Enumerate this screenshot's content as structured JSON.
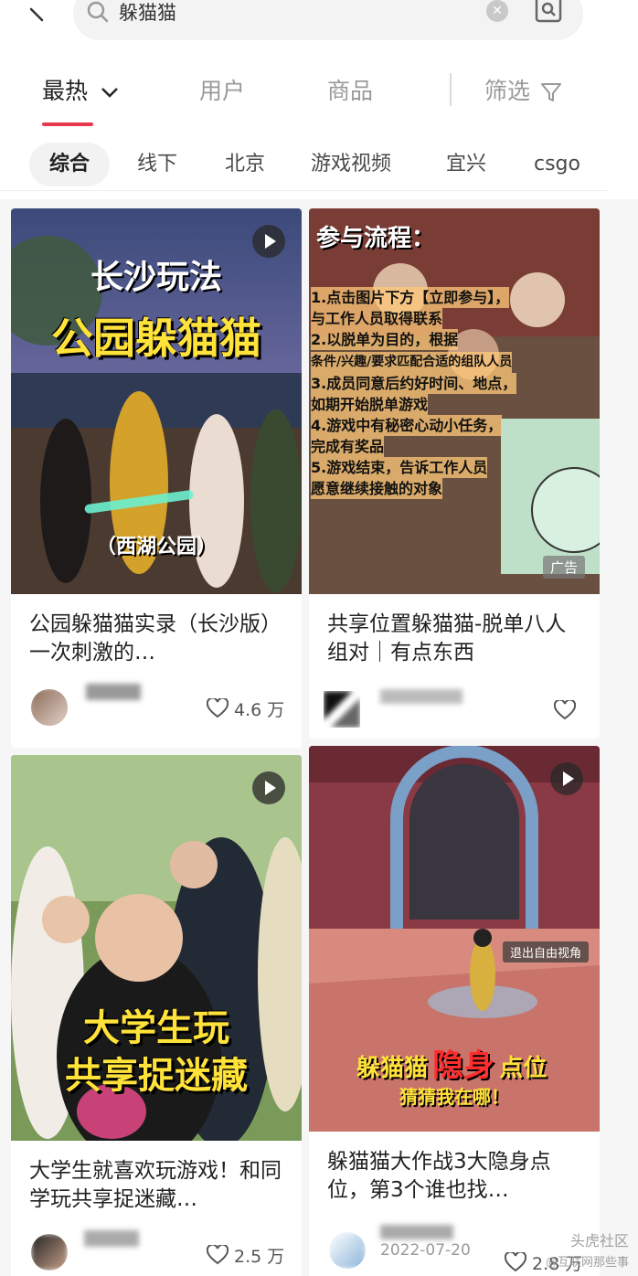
{
  "search": {
    "query": "躲猫猫"
  },
  "tabs": [
    {
      "label": "最热"
    },
    {
      "label": "用户"
    },
    {
      "label": "商品"
    },
    {
      "label": "筛选"
    }
  ],
  "chips": [
    "综合",
    "线下",
    "北京",
    "游戏视频",
    "宜兴",
    "csgo"
  ],
  "cards": [
    {
      "thumb_lines": [
        "长沙玩法",
        "公园躲猫猫",
        "（西湖公园）"
      ],
      "title": "公园躲猫猫实录（长沙版）一次刺激的…",
      "likes": "4.6 万"
    },
    {
      "thumb_lines": [
        "参与流程：",
        "1.点击图片下方【立即参与】，",
        "与工作人员取得联系",
        "2.以脱单为目的，根据",
        "条件/兴趣/要求匹配合适的组队人员",
        "3.成员同意后约好时间、地点，",
        "如期开始脱单游戏",
        "4.游戏中有秘密心动小任务，",
        "完成有奖品",
        "5.游戏结束，告诉工作人员",
        "愿意继续接触的对象"
      ],
      "ad_label": "广告",
      "title": "共享位置躲猫猫-脱单八人组对｜有点东西",
      "likes": ""
    },
    {
      "thumb_lines": [
        "大学生玩",
        "共享捉迷藏"
      ],
      "title": "大学生就喜欢玩游戏！和同学玩共享捉迷藏…",
      "likes": "2.5 万"
    },
    {
      "thumb_lines": [
        "躲猫猫",
        "隐身",
        "点位",
        "猜猜我在哪！",
        "退出自由视角"
      ],
      "title": "躲猫猫大作战3大隐身点位，第3个谁也找…",
      "date": "2022-07-20",
      "likes": "2.8 万"
    }
  ],
  "watermark": {
    "line1": "头虎社区",
    "line2": "@互联网那些事"
  }
}
